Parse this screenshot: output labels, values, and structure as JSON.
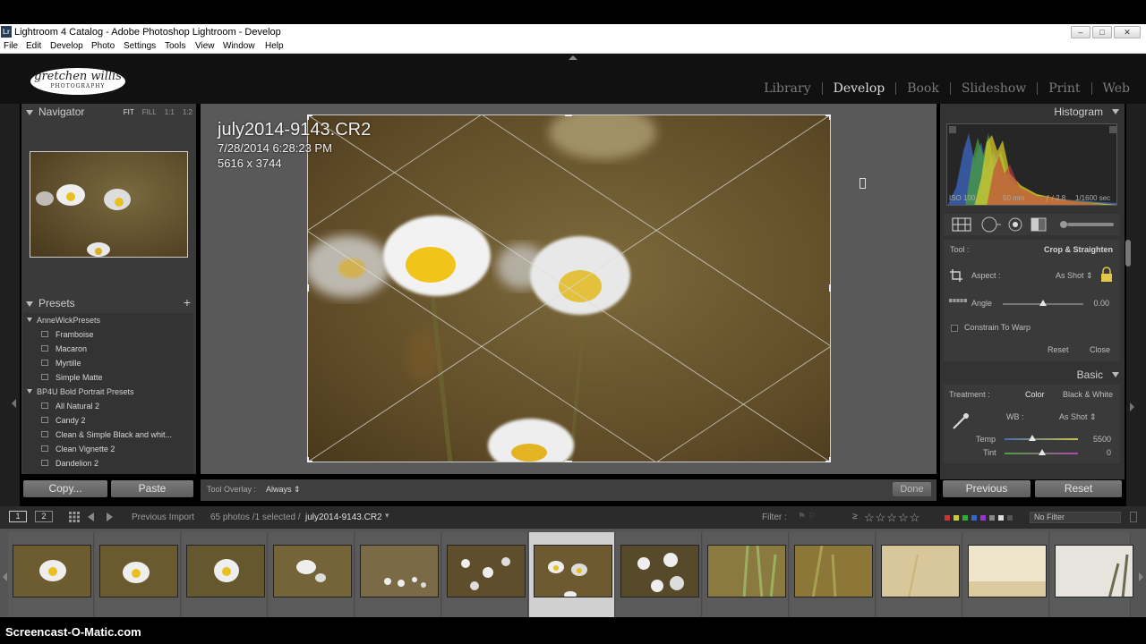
{
  "window": {
    "app_badge": "Lr",
    "title": "Lightroom 4 Catalog - Adobe Photoshop Lightroom - Develop"
  },
  "menu": [
    "File",
    "Edit",
    "Develop",
    "Photo",
    "Settings",
    "Tools",
    "View",
    "Window",
    "Help"
  ],
  "identity_plate": {
    "name": "gretchen willis",
    "tagline": "PHOTOGRAPHY"
  },
  "modules": [
    "Library",
    "Develop",
    "Book",
    "Slideshow",
    "Print",
    "Web"
  ],
  "active_module": "Develop",
  "navigator": {
    "title": "Navigator",
    "zoom_options": [
      "FIT",
      "FILL",
      "1:1",
      "1:2"
    ],
    "active_zoom": "FIT"
  },
  "presets": {
    "title": "Presets",
    "add": "+",
    "folders": [
      {
        "name": "AnneWickPresets",
        "items": [
          "Framboise",
          "Macaron",
          "Myrtille",
          "Simple Matte"
        ]
      },
      {
        "name": "BP4U Bold Portrait Presets",
        "items": [
          "All Natural  2",
          "Candy 2",
          "Clean & Simple Black and whit...",
          "Clean Vignette 2",
          "Dandelion  2"
        ]
      }
    ]
  },
  "left_buttons": {
    "copy": "Copy...",
    "paste": "Paste"
  },
  "photo_info": {
    "filename": "july2014-9143.CR2",
    "datetime": "7/28/2014 6:28:23 PM",
    "dimensions": "5616 x 3744"
  },
  "toolbar": {
    "overlay_label": "Tool Overlay :",
    "overlay_value": "Always",
    "done": "Done"
  },
  "histogram": {
    "title": "Histogram",
    "iso": "ISO 100",
    "focal": "50 mm",
    "aperture": "ƒ / 2.8",
    "shutter": "1/1600 sec"
  },
  "crop": {
    "tool_label": "Tool :",
    "tool_name": "Crop & Straighten",
    "aspect_label": "Aspect :",
    "aspect_value": "As Shot",
    "angle_label": "Angle",
    "angle_value": "0.00",
    "constrain": "Constrain To Warp",
    "reset": "Reset",
    "close": "Close"
  },
  "basic": {
    "title": "Basic",
    "treatment_label": "Treatment :",
    "color": "Color",
    "bw": "Black & White",
    "wb_label": "WB :",
    "wb_value": "As Shot",
    "temp_label": "Temp",
    "temp_value": "5500",
    "tint_label": "Tint",
    "tint_value": "0"
  },
  "right_buttons": {
    "previous": "Previous",
    "reset": "Reset"
  },
  "filmstrip_bar": {
    "page1": "1",
    "page2": "2",
    "source": "Previous Import",
    "count": "65 photos /1 selected /",
    "selected_file": "july2014-9143.CR2",
    "filter_label": "Filter :",
    "stars_prefix": "≥",
    "stars": "☆☆☆☆☆",
    "filter_value": "No Filter"
  },
  "colors": {
    "panel": "#3a3a3a",
    "center_bg": "#595959",
    "label_red": "#c33",
    "label_yellow": "#cc3",
    "label_green": "#3a3",
    "label_blue": "#36c",
    "label_purple": "#93c"
  },
  "watermark": "Screencast-O-Matic.com"
}
